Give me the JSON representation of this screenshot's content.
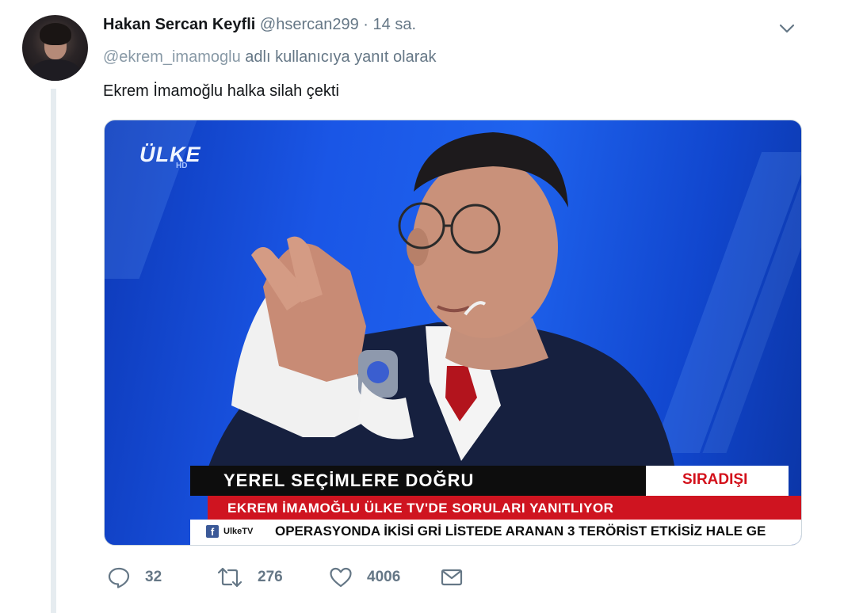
{
  "tweet": {
    "author_name": "Hakan Sercan Keyfli",
    "author_handle": "@hsercan299",
    "separator": "·",
    "time": "14 sa.",
    "reply_handle": "@ekrem_imamoglu",
    "reply_suffix": "adlı kullanıcıya yanıt olarak",
    "text": "Ekrem İmamoğlu halka silah çekti"
  },
  "media": {
    "channel_logo": "ÜLKE",
    "channel_logo_sub": "HD",
    "ticker_top": "YEREL SEÇİMLERE DOĞRU",
    "ticker_top_right": "SIRADIŞI",
    "ticker_middle": "EKREM İMAMOĞLU ÜLKE TV'DE SORULARI YANITLIYOR",
    "ticker_brand": "UlkeTV",
    "ticker_bottom": "OPERASYONDA İKİSİ GRİ LİSTEDE ARANAN 3 TERÖRİST ETKİSİZ HALE GE"
  },
  "actions": {
    "reply_count": "32",
    "retweet_count": "276",
    "like_count": "4006"
  },
  "icons": {
    "caret": "chevron-down-icon",
    "reply": "reply-icon",
    "retweet": "retweet-icon",
    "like": "heart-icon",
    "dm": "envelope-icon"
  },
  "colors": {
    "secondary_text": "#657786",
    "ticker_red": "#cf1420",
    "tv_blue": "#1a56e6"
  }
}
